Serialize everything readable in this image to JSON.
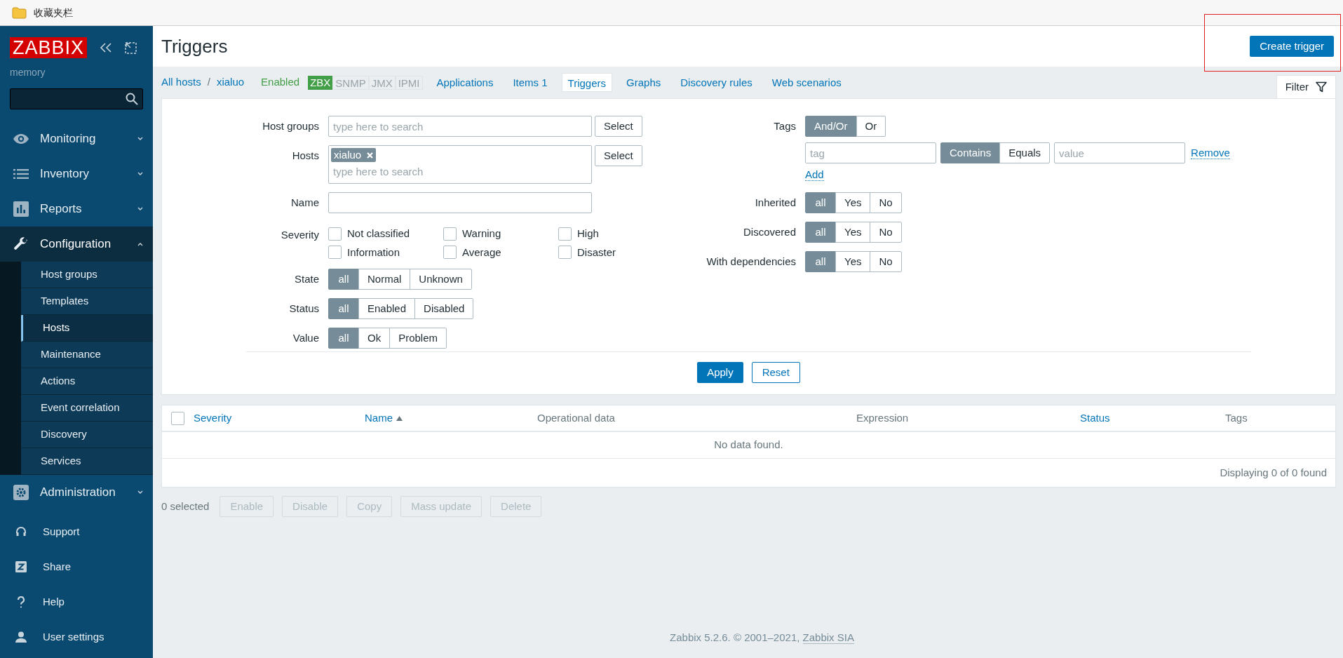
{
  "bookmarks_bar": {
    "label": "收藏夹栏"
  },
  "sidebar": {
    "logo": "ZABBIX",
    "server_name": "memory",
    "menu": [
      {
        "label": "Monitoring",
        "expanded": false
      },
      {
        "label": "Inventory",
        "expanded": false
      },
      {
        "label": "Reports",
        "expanded": false
      },
      {
        "label": "Configuration",
        "expanded": true,
        "children": [
          {
            "label": "Host groups",
            "selected": false
          },
          {
            "label": "Templates",
            "selected": false
          },
          {
            "label": "Hosts",
            "selected": true
          },
          {
            "label": "Maintenance",
            "selected": false
          },
          {
            "label": "Actions",
            "selected": false
          },
          {
            "label": "Event correlation",
            "selected": false
          },
          {
            "label": "Discovery",
            "selected": false
          },
          {
            "label": "Services",
            "selected": false
          }
        ]
      },
      {
        "label": "Administration",
        "expanded": false
      }
    ],
    "bottom_links": [
      "Support",
      "Share",
      "Help",
      "User settings"
    ]
  },
  "header": {
    "title": "Triggers",
    "create_button": {
      "label": "Create trigger",
      "highlighted": true
    }
  },
  "host_nav": {
    "breadcrumbs": [
      "All hosts",
      "xialuo"
    ],
    "breadcrumb_separator": "/",
    "host_status": "Enabled",
    "availability": [
      {
        "label": "ZBX",
        "on": true
      },
      {
        "label": "SNMP",
        "on": false
      },
      {
        "label": "JMX",
        "on": false
      },
      {
        "label": "IPMI",
        "on": false
      }
    ],
    "tabs": [
      {
        "label": "Applications",
        "selected": false
      },
      {
        "label": "Items 1",
        "selected": false
      },
      {
        "label": "Triggers",
        "selected": true
      },
      {
        "label": "Graphs",
        "selected": false
      },
      {
        "label": "Discovery rules",
        "selected": false
      },
      {
        "label": "Web scenarios",
        "selected": false
      }
    ],
    "filter_tab": {
      "label": "Filter"
    }
  },
  "filter": {
    "host_groups": {
      "label": "Host groups",
      "placeholder": "type here to search",
      "button": "Select"
    },
    "hosts": {
      "label": "Hosts",
      "selected": [
        "xialuo"
      ],
      "placeholder": "type here to search",
      "button": "Select"
    },
    "name": {
      "label": "Name"
    },
    "severity": {
      "label": "Severity",
      "options": [
        {
          "label": "Not classified",
          "checked": false
        },
        {
          "label": "Warning",
          "checked": false
        },
        {
          "label": "High",
          "checked": false
        },
        {
          "label": "Information",
          "checked": false
        },
        {
          "label": "Average",
          "checked": false
        },
        {
          "label": "Disaster",
          "checked": false
        }
      ]
    },
    "left_groups": [
      {
        "label": "State",
        "options": [
          {
            "label": "all",
            "selected": true
          },
          {
            "label": "Normal",
            "selected": false
          },
          {
            "label": "Unknown",
            "selected": false
          }
        ]
      },
      {
        "label": "Status",
        "options": [
          {
            "label": "all",
            "selected": true
          },
          {
            "label": "Enabled",
            "selected": false
          },
          {
            "label": "Disabled",
            "selected": false
          }
        ]
      },
      {
        "label": "Value",
        "options": [
          {
            "label": "all",
            "selected": true
          },
          {
            "label": "Ok",
            "selected": false
          },
          {
            "label": "Problem",
            "selected": false
          }
        ]
      }
    ],
    "tags": {
      "label": "Tags",
      "operator": [
        {
          "label": "And/Or",
          "selected": true
        },
        {
          "label": "Or",
          "selected": false
        }
      ],
      "rows": [
        {
          "tag_placeholder": "tag",
          "match": [
            {
              "label": "Contains",
              "selected": true
            },
            {
              "label": "Equals",
              "selected": false
            }
          ],
          "value_placeholder": "value",
          "remove": "Remove"
        }
      ],
      "add": "Add"
    },
    "right_groups": [
      {
        "label": "Inherited",
        "options": [
          {
            "label": "all",
            "selected": true
          },
          {
            "label": "Yes",
            "selected": false
          },
          {
            "label": "No",
            "selected": false
          }
        ]
      },
      {
        "label": "Discovered",
        "options": [
          {
            "label": "all",
            "selected": true
          },
          {
            "label": "Yes",
            "selected": false
          },
          {
            "label": "No",
            "selected": false
          }
        ]
      },
      {
        "label": "With dependencies",
        "options": [
          {
            "label": "all",
            "selected": true
          },
          {
            "label": "Yes",
            "selected": false
          },
          {
            "label": "No",
            "selected": false
          }
        ]
      }
    ],
    "apply": "Apply",
    "reset": "Reset"
  },
  "table": {
    "select_all_checked": false,
    "columns": [
      {
        "label": "Severity",
        "link": true,
        "sorted": false
      },
      {
        "label": "Name",
        "link": true,
        "sorted": true
      },
      {
        "label": "Operational data",
        "link": false,
        "sorted": false
      },
      {
        "label": "Expression",
        "link": false,
        "sorted": false
      },
      {
        "label": "Status",
        "link": true,
        "sorted": false
      },
      {
        "label": "Tags",
        "link": false,
        "sorted": false
      }
    ],
    "empty_message": "No data found.",
    "summary": "Displaying 0 of 0 found"
  },
  "actions": {
    "selected_count": "0 selected",
    "buttons": [
      {
        "label": "Enable",
        "disabled": true
      },
      {
        "label": "Disable",
        "disabled": true
      },
      {
        "label": "Copy",
        "disabled": true
      },
      {
        "label": "Mass update",
        "disabled": true
      },
      {
        "label": "Delete",
        "disabled": true
      }
    ]
  },
  "footer": {
    "text": "Zabbix 5.2.6. © 2001–2021, ",
    "link": "Zabbix SIA"
  }
}
